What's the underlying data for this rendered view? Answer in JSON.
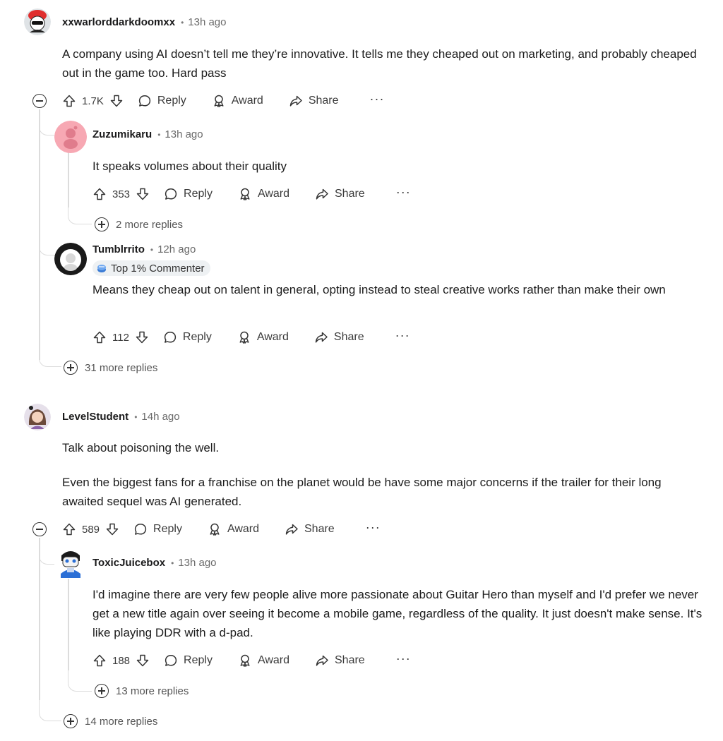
{
  "comments": [
    {
      "user": "xxwarlorddarkdoomxx",
      "time": "13h ago",
      "body": [
        "A company using AI doesn’t tell me they’re innovative. It tells me they cheaped out on marketing, and probably cheaped out in the game too. Hard pass"
      ],
      "votes": "1.7K",
      "replies": [
        {
          "user": "Zuzumikaru",
          "time": "13h ago",
          "body": [
            "It speaks volumes about their quality"
          ],
          "votes": "353",
          "more_replies": "2 more replies"
        },
        {
          "user": "Tumblrrito",
          "time": "12h ago",
          "badge": "Top 1% Commenter",
          "body": [
            "Means they cheap out on talent in general, opting instead to steal creative works rather than make their own"
          ],
          "votes": "112"
        }
      ],
      "more_replies": "31 more replies"
    },
    {
      "user": "LevelStudent",
      "time": "14h ago",
      "body": [
        "Talk about poisoning the well.",
        "Even the biggest fans for a franchise on the planet would be have some major concerns if the trailer for their long awaited sequel was AI generated."
      ],
      "votes": "589",
      "replies": [
        {
          "user": "ToxicJuicebox",
          "time": "13h ago",
          "body": [
            "I'd imagine there are very few people alive more passionate about Guitar Hero than myself and I'd prefer we never get a new title again over seeing it become a mobile game, regardless of the quality. It just doesn't make sense. It's like playing DDR with a d-pad."
          ],
          "votes": "188",
          "more_replies": "13 more replies"
        }
      ],
      "more_replies": "14 more replies"
    }
  ],
  "actions": {
    "reply": "Reply",
    "award": "Award",
    "share": "Share",
    "more": "···"
  },
  "icons": {
    "upvote": "upvote-arrow-icon",
    "downvote": "downvote-arrow-icon",
    "reply": "speech-bubble-icon",
    "award": "award-ribbon-icon",
    "share": "share-arrow-icon",
    "collapse": "collapse-minus-icon",
    "expand": "expand-plus-icon",
    "badge": "top-commenter-icon"
  },
  "colors": {
    "avatar_red": "#e02e2e",
    "avatar_pink": "#f7a8b3",
    "badge_bg": "#eef1f3"
  }
}
